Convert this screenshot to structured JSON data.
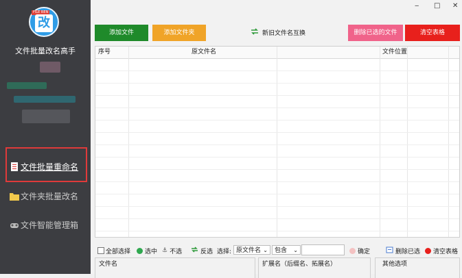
{
  "sidebar": {
    "logo_tag": "FILE REN",
    "logo_char": "改",
    "app_title": "文件批量改名高手",
    "nav": [
      {
        "label": "文件批量重命名",
        "icon": "document-icon",
        "active": true
      },
      {
        "label": "文件夹批量改名",
        "icon": "folder-icon",
        "active": false
      },
      {
        "label": "文件智能管理箱",
        "icon": "gamepad-icon",
        "active": false
      }
    ]
  },
  "window": {
    "minimize": "‒",
    "maximize": "□",
    "close": "✕"
  },
  "actions": {
    "add_file": "添加文件",
    "add_folder": "添加文件夹",
    "swap_names": "新旧文件名互换",
    "delete_selected": "删除已选的文件",
    "clear_table": "清空表格",
    "colors": {
      "add_file": "#1f8a2a",
      "add_folder": "#f0a428",
      "delete_selected": "#f0638a",
      "clear_table": "#e8201c"
    }
  },
  "table": {
    "columns": [
      "序号",
      "原文件名",
      "文件位置"
    ]
  },
  "toolbar": {
    "select_all": "全部选择",
    "select": "选中",
    "deselect": "不选",
    "invert": "反选",
    "choose_label": "选择:",
    "field_select": "原文件名",
    "match_select": "包含",
    "confirm": "确定",
    "delete_selected": "删除已选",
    "clear_table": "清空表格"
  },
  "options": {
    "filename_section": "文件名",
    "extension_section": "扩展名（后缀名、拓展名）",
    "other_section": "其他选项"
  }
}
